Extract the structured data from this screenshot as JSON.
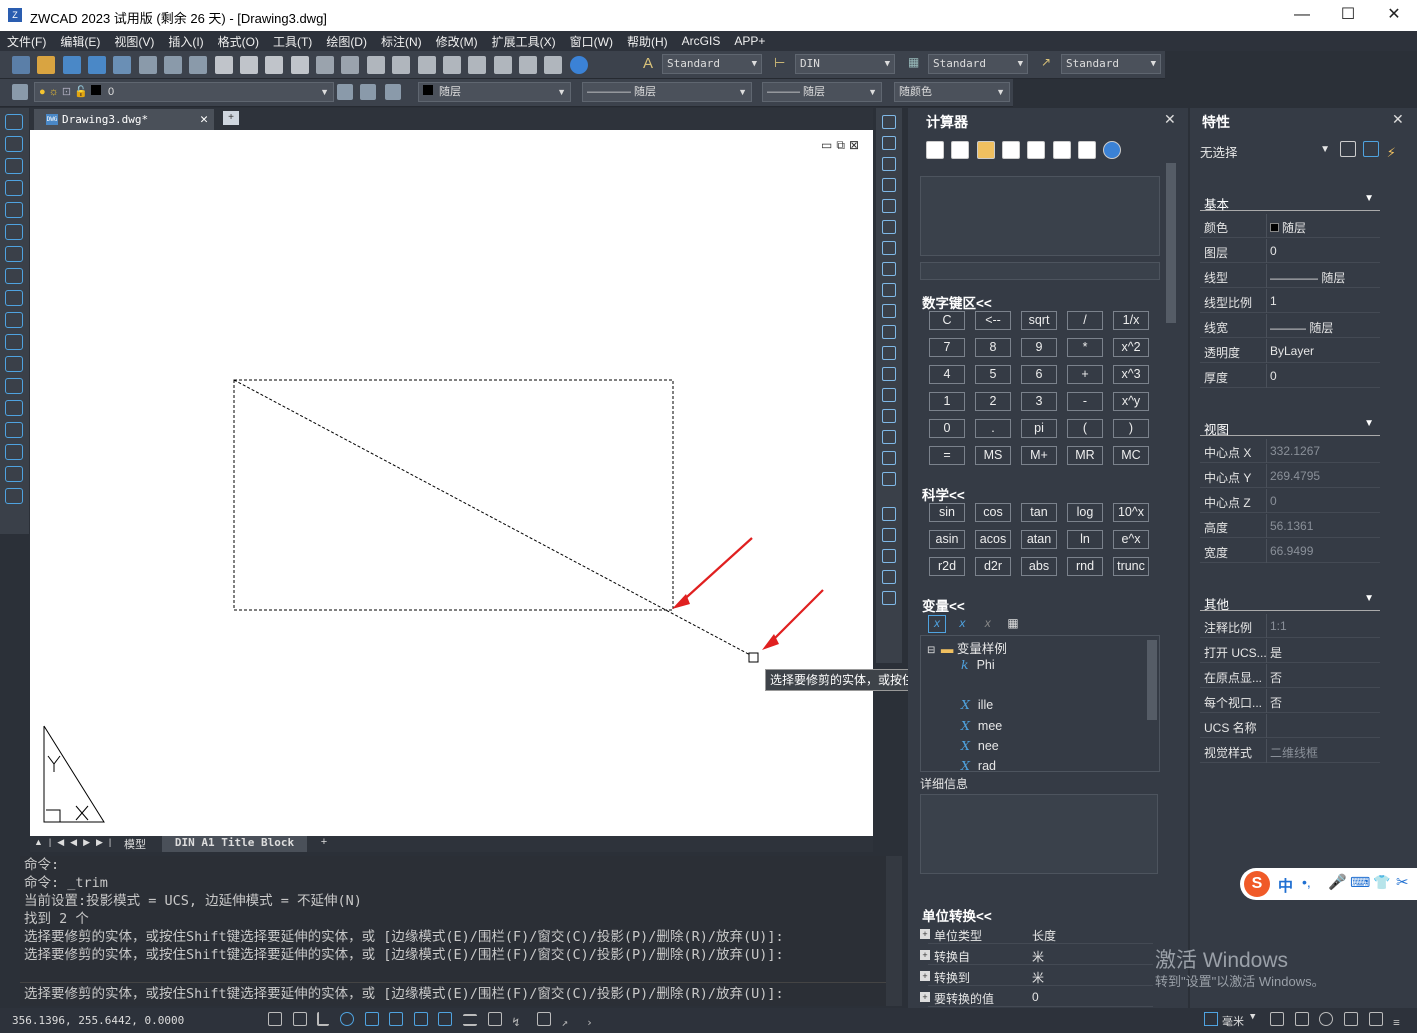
{
  "window": {
    "title": "ZWCAD 2023 试用版 (剩余 26 天) - [Drawing3.dwg]",
    "app_icon": "zwcad-logo-icon",
    "minimize": "—",
    "maximize": "☐",
    "close": "✕"
  },
  "menu": [
    "文件(F)",
    "编辑(E)",
    "视图(V)",
    "插入(I)",
    "格式(O)",
    "工具(T)",
    "绘图(D)",
    "标注(N)",
    "修改(M)",
    "扩展工具(X)",
    "窗口(W)",
    "帮助(H)",
    "ArcGIS",
    "APP+"
  ],
  "toolbar1": {
    "text_style": "Standard",
    "dim_style": "DIN",
    "table_style": "Standard",
    "multileader_style": "Standard"
  },
  "toolbar2": {
    "layer": "0",
    "color": "随层",
    "linetype": "———— 随层",
    "lineweight": "——— 随层",
    "plot_style": "随颜色"
  },
  "document_tab": "Drawing3.dwg*",
  "layout_tabs": [
    "模型",
    "DIN A1 Title Block",
    "+"
  ],
  "tooltip": "选择要修剪的实体，或按住Shift键选择要延伸的实体，或",
  "command_history": [
    "命令:",
    "命令: _trim",
    "当前设置:投影模式 = UCS, 边延伸模式 = 不延伸(N)",
    "找到 2 个",
    "选择要修剪的实体，或按住Shift键选择要延伸的实体，或 [边缘模式(E)/围栏(F)/窗交(C)/投影(P)/删除(R)/放弃(U)]:",
    "选择要修剪的实体，或按住Shift键选择要延伸的实体，或 [边缘模式(E)/围栏(F)/窗交(C)/投影(P)/删除(R)/放弃(U)]:"
  ],
  "command_prompt": "选择要修剪的实体，或按住Shift键选择要延伸的实体，或 [边缘模式(E)/围栏(F)/窗交(C)/投影(P)/删除(R)/放弃(U)]:",
  "status": {
    "coords": "356.1396, 255.6442, 0.0000",
    "units": "毫米"
  },
  "calculator": {
    "title": "计算器",
    "numpad_title": "数字键区<<",
    "numpad": [
      [
        "C",
        "<--",
        "sqrt",
        "/",
        "1/x"
      ],
      [
        "7",
        "8",
        "9",
        "*",
        "x^2"
      ],
      [
        "4",
        "5",
        "6",
        "+",
        "x^3"
      ],
      [
        "1",
        "2",
        "3",
        "-",
        "x^y"
      ],
      [
        "0",
        ".",
        "pi",
        "(",
        ")"
      ],
      [
        "=",
        "MS",
        "M+",
        "MR",
        "MC"
      ]
    ],
    "sci_title": "科学<<",
    "sci": [
      [
        "sin",
        "cos",
        "tan",
        "log",
        "10^x"
      ],
      [
        "asin",
        "acos",
        "atan",
        "ln",
        "e^x"
      ],
      [
        "r2d",
        "d2r",
        "abs",
        "rnd",
        "trunc"
      ]
    ],
    "vars_title": "变量<<",
    "var_folder": "变量样例",
    "var_k": "k",
    "vars": [
      "Phi",
      "ille",
      "mee",
      "nee",
      "rad"
    ],
    "details_label": "详细信息",
    "unit_title": "单位转换<<",
    "units": [
      {
        "k": "单位类型",
        "v": "长度"
      },
      {
        "k": "转换自",
        "v": "米"
      },
      {
        "k": "转换到",
        "v": "米"
      },
      {
        "k": "要转换的值",
        "v": "0"
      }
    ]
  },
  "properties": {
    "title": "特性",
    "selection": "无选择",
    "groups": {
      "basic": "基本",
      "view": "视图",
      "misc": "其他"
    },
    "basic": [
      {
        "k": "颜色",
        "v": "随层"
      },
      {
        "k": "图层",
        "v": "0"
      },
      {
        "k": "线型",
        "v": "———— 随层"
      },
      {
        "k": "线型比例",
        "v": "1"
      },
      {
        "k": "线宽",
        "v": "——— 随层"
      },
      {
        "k": "透明度",
        "v": "ByLayer"
      },
      {
        "k": "厚度",
        "v": "0"
      }
    ],
    "view": [
      {
        "k": "中心点 X",
        "v": "332.1267"
      },
      {
        "k": "中心点 Y",
        "v": "269.4795"
      },
      {
        "k": "中心点 Z",
        "v": "0"
      },
      {
        "k": "高度",
        "v": "56.1361"
      },
      {
        "k": "宽度",
        "v": "66.9499"
      }
    ],
    "misc": [
      {
        "k": "注释比例",
        "v": "1:1"
      },
      {
        "k": "打开 UCS...",
        "v": "是"
      },
      {
        "k": "在原点显...",
        "v": "否"
      },
      {
        "k": "每个视口...",
        "v": "否"
      },
      {
        "k": "UCS 名称",
        "v": ""
      },
      {
        "k": "视觉样式",
        "v": "二维线框"
      }
    ]
  },
  "watermark": {
    "line1": "激活 Windows",
    "line2": "转到\"设置\"以激活 Windows。"
  },
  "ime": "中"
}
